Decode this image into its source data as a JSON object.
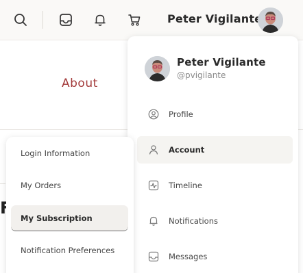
{
  "header": {
    "user_name": "Peter Vigilante",
    "icons": [
      "search-icon",
      "inbox-icon",
      "bell-icon",
      "cart-icon"
    ]
  },
  "page": {
    "about_label": "About",
    "partial_heading": "F"
  },
  "user_menu": {
    "name": "Peter Vigilante",
    "handle": "@pvigilante",
    "items": [
      {
        "label": "Profile",
        "icon": "user-circle-icon"
      },
      {
        "label": "Account",
        "icon": "user-icon",
        "active": true
      },
      {
        "label": "Timeline",
        "icon": "activity-icon"
      },
      {
        "label": "Notifications",
        "icon": "bell-icon"
      },
      {
        "label": "Messages",
        "icon": "inbox-icon"
      }
    ]
  },
  "account_submenu": {
    "items": [
      {
        "label": "Login Information"
      },
      {
        "label": "My Orders"
      },
      {
        "label": "My Subscription",
        "active": true
      },
      {
        "label": "Notification Preferences"
      }
    ]
  },
  "colors": {
    "accent_link": "#a33a3a",
    "header_bg": "#faf9f7",
    "active_bg": "#f5f4f1"
  }
}
